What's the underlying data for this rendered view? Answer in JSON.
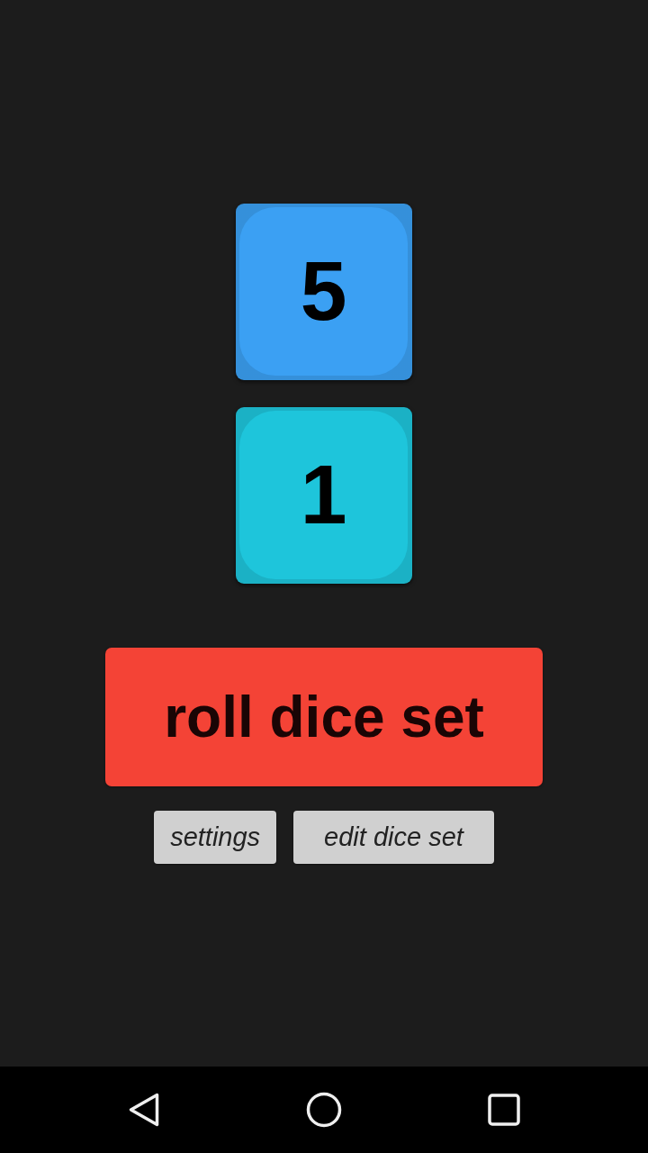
{
  "dice": [
    {
      "value": "5",
      "color": "#3ba0f3"
    },
    {
      "value": "1",
      "color": "#1ec5db"
    }
  ],
  "roll_button": {
    "label": "roll dice set"
  },
  "buttons": [
    {
      "label": "settings"
    },
    {
      "label": "edit dice set"
    }
  ]
}
